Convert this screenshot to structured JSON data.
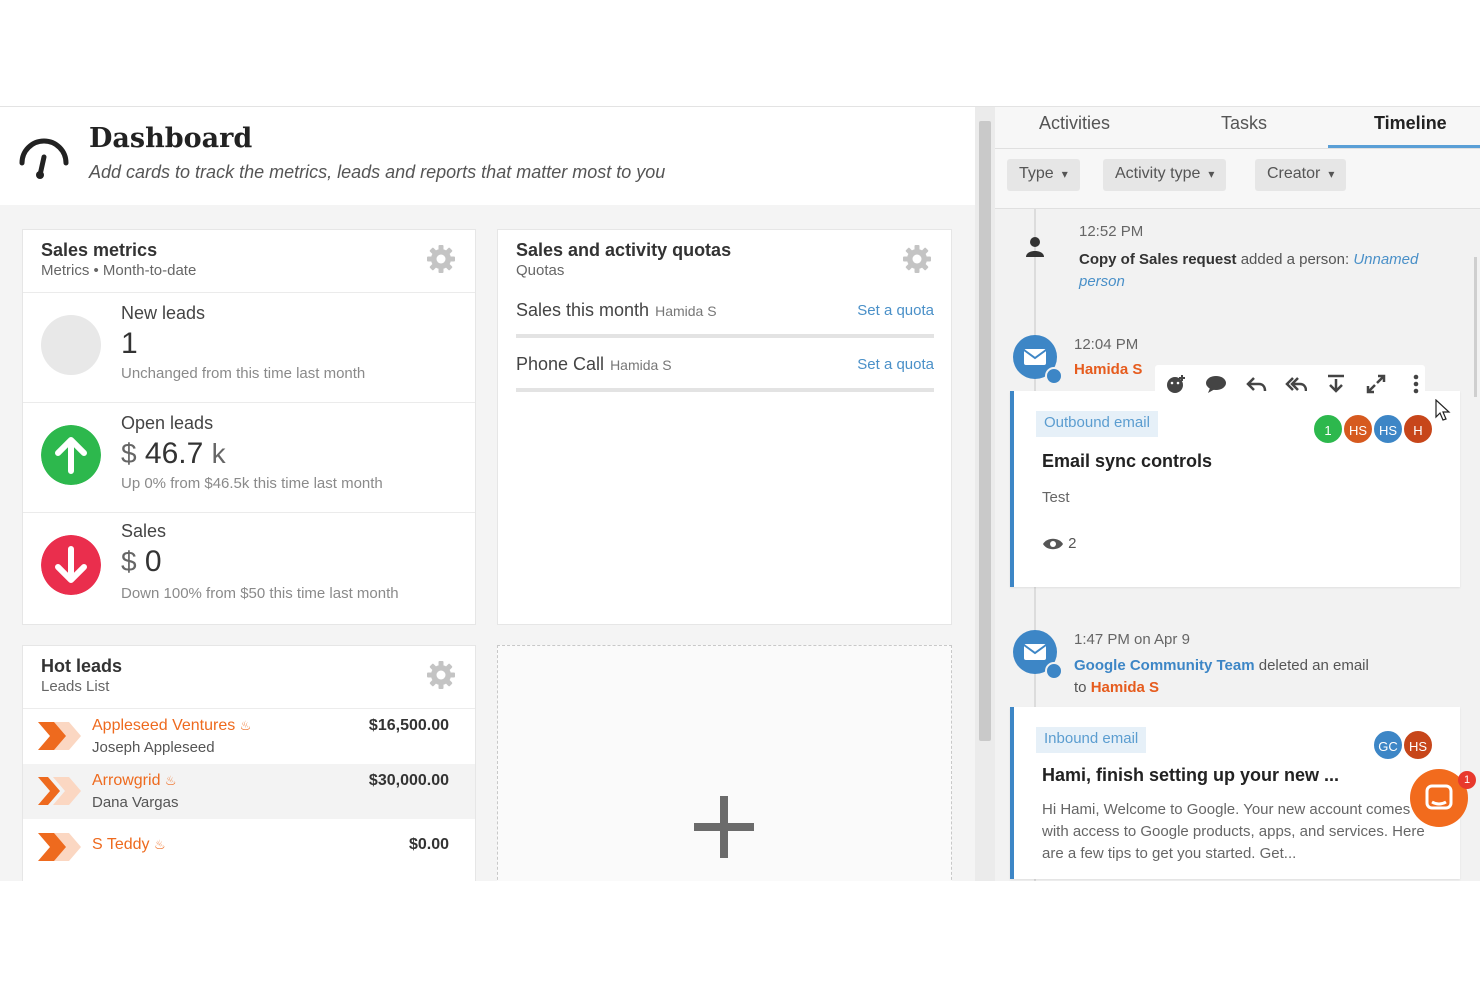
{
  "dashboard": {
    "title": "Dashboard",
    "subtitle": "Add cards to track the metrics, leads and reports that matter most to you"
  },
  "sales_metrics": {
    "title": "Sales metrics",
    "subtitle": "Metrics • Month-to-date",
    "metrics": [
      {
        "label": "New leads",
        "currency": "",
        "value": "1",
        "unit": "",
        "delta": "Unchanged from this time last month",
        "trend": "neutral",
        "color": "#e8e8e8"
      },
      {
        "label": "Open leads",
        "currency": "$",
        "value": "46.7",
        "unit": "k",
        "delta": "Up 0% from $46.5k this time last month",
        "trend": "up",
        "color": "#2db84d"
      },
      {
        "label": "Sales",
        "currency": "$",
        "value": "0",
        "unit": "",
        "delta": "Down 100% from $50 this time last month",
        "trend": "down",
        "color": "#ea2e4d"
      }
    ]
  },
  "quotas": {
    "title": "Sales and activity quotas",
    "subtitle": "Quotas",
    "rows": [
      {
        "name": "Sales this month",
        "owner": "Hamida S",
        "action": "Set a quota"
      },
      {
        "name": "Phone Call",
        "owner": "Hamida S",
        "action": "Set a quota"
      }
    ]
  },
  "hot_leads": {
    "title": "Hot leads",
    "subtitle": "Leads List",
    "rows": [
      {
        "name": "Appleseed Ventures",
        "person": "Joseph Appleseed",
        "amount": "$16,500.00"
      },
      {
        "name": "Arrowgrid",
        "person": "Dana Vargas",
        "amount": "$30,000.00"
      },
      {
        "name": "S Teddy",
        "person": "",
        "amount": "$0.00"
      }
    ]
  },
  "right_panel": {
    "tabs": [
      "Activities",
      "Tasks",
      "Timeline"
    ],
    "active_tab": "Timeline",
    "filters": [
      "Type",
      "Activity type",
      "Creator"
    ],
    "events": [
      {
        "time": "12:52 PM",
        "bold": "Copy of Sales request",
        "text": " added a person: ",
        "link": "Unnamed person"
      },
      {
        "time": "12:04 PM",
        "actor": "Hamida S",
        "tag": "Outbound email",
        "subject": "Email sync controls",
        "body": "Test",
        "views": "2",
        "avatars": [
          "1",
          "HS",
          "HS",
          "H"
        ]
      },
      {
        "time": "1:47 PM on Apr 9",
        "actor": "Google Community Team",
        "text": " deleted an email",
        "to_prefix": "to ",
        "to": "Hamida S",
        "tag": "Inbound email",
        "subject": "Hami, finish setting up your new ...",
        "body": "Hi Hami, Welcome to Google. Your new account comes with access to Google products, apps, and services. Here are a few tips to get you started. Get...",
        "avatars": [
          "GC",
          "HS"
        ]
      }
    ],
    "chat_badge": "1"
  },
  "colors": {
    "accent_blue": "#3d86c6",
    "accent_orange": "#ee6a1e",
    "up_green": "#2db84d",
    "down_red": "#ea2e4d"
  },
  "icons": [
    "speedometer-icon",
    "gear-icon",
    "arrow-up-icon",
    "arrow-down-icon",
    "lead-chevron-icon",
    "flame-icon",
    "plus-icon",
    "chevron-down-icon",
    "person-icon",
    "mail-icon",
    "add-reaction-icon",
    "comment-icon",
    "reply-icon",
    "reply-all-icon",
    "download-icon",
    "expand-icon",
    "more-vertical-icon",
    "eye-icon",
    "chat-icon"
  ]
}
